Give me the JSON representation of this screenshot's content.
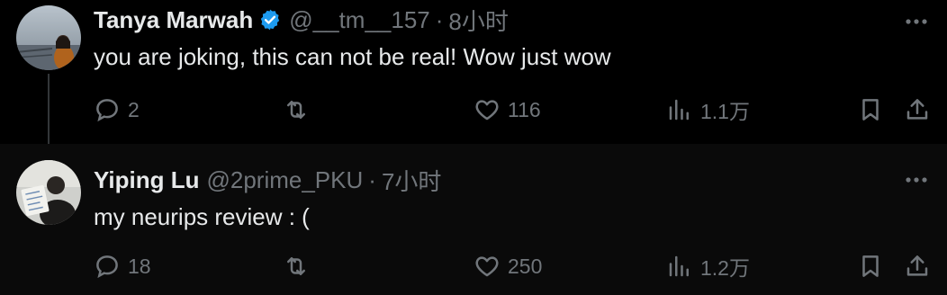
{
  "tweets": [
    {
      "name": "Tanya Marwah",
      "verified": true,
      "handle": "@__tm__157",
      "separator": "·",
      "time": "8小时",
      "text": "you are joking, this can not be real! Wow just wow",
      "replies": "2",
      "retweets": "",
      "likes": "116",
      "views": "1.1万"
    },
    {
      "name": "Yiping Lu",
      "verified": false,
      "handle": "@2prime_PKU",
      "separator": "·",
      "time": "7小时",
      "text": "my neurips review : (",
      "replies": "18",
      "retweets": "",
      "likes": "250",
      "views": "1.2万"
    }
  ],
  "colors": {
    "background": "#000000",
    "text": "#e7e9ea",
    "secondary": "#71767b",
    "verified": "#1d9bf0"
  }
}
